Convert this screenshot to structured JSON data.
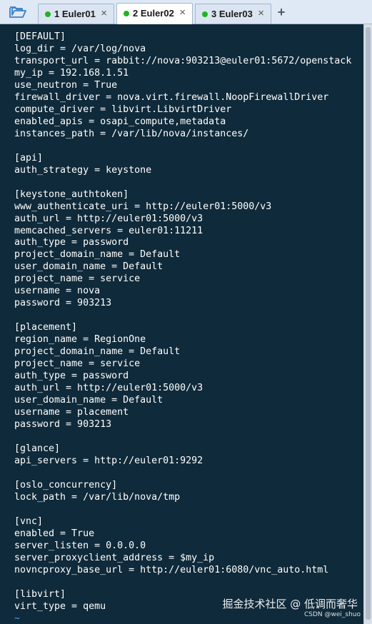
{
  "tabs": [
    {
      "label": "1 Euler01",
      "active": false
    },
    {
      "label": "2 Euler02",
      "active": true
    },
    {
      "label": "3 Euler03",
      "active": false
    }
  ],
  "icons": {
    "folder": "folder-open-icon",
    "close": "close-icon",
    "add": "plus-icon"
  },
  "close_glyph": "×",
  "add_glyph": "+",
  "colors": {
    "terminal_bg": "#0f2a3a",
    "terminal_fg": "#ffffff",
    "tab_status": "#1fb521",
    "tilde": "#4aa3ff"
  },
  "terminal": {
    "lines": [
      "[DEFAULT]",
      "log_dir = /var/log/nova",
      "transport_url = rabbit://nova:903213@euler01:5672/openstack",
      "my_ip = 192.168.1.51",
      "use_neutron = True",
      "firewall_driver = nova.virt.firewall.NoopFirewallDriver",
      "compute_driver = libvirt.LibvirtDriver",
      "enabled_apis = osapi_compute,metadata",
      "instances_path = /var/lib/nova/instances/",
      "",
      "[api]",
      "auth_strategy = keystone",
      "",
      "[keystone_authtoken]",
      "www_authenticate_uri = http://euler01:5000/v3",
      "auth_url = http://euler01:5000/v3",
      "memcached_servers = euler01:11211",
      "auth_type = password",
      "project_domain_name = Default",
      "user_domain_name = Default",
      "project_name = service",
      "username = nova",
      "password = 903213",
      "",
      "[placement]",
      "region_name = RegionOne",
      "project_domain_name = Default",
      "project_name = service",
      "auth_type = password",
      "auth_url = http://euler01:5000/v3",
      "user_domain_name = Default",
      "username = placement",
      "password = 903213",
      "",
      "[glance]",
      "api_servers = http://euler01:9292",
      "",
      "[oslo_concurrency]",
      "lock_path = /var/lib/nova/tmp",
      "",
      "[vnc]",
      "enabled = True",
      "server_listen = 0.0.0.0",
      "server_proxyclient_address = $my_ip",
      "novncproxy_base_url = http://euler01:6080/vnc_auto.html",
      "",
      "[libvirt]",
      "virt_type = qemu"
    ],
    "tilde": "~"
  },
  "watermark": {
    "main": "掘金技术社区 @ 低调而奢华",
    "sub": "CSDN @wei_shuo"
  }
}
